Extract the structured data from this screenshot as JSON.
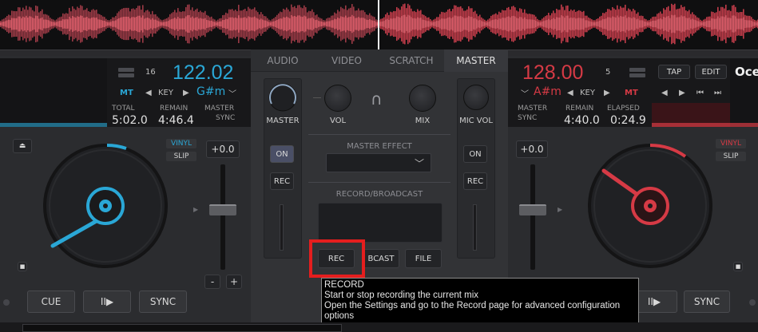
{
  "mixer": {
    "tabs": [
      "AUDIO",
      "VIDEO",
      "SCRATCH",
      "MASTER"
    ],
    "active_tab": "MASTER",
    "master_label": "MASTER",
    "on_label": "ON",
    "rec_label": "REC",
    "vol_label": "VOL",
    "mix_label": "MIX",
    "mic_vol_label": "MIC VOL",
    "master_effect_label": "MASTER EFFECT",
    "record_broadcast_label": "RECORD/BROADCAST",
    "rec_button": "REC",
    "bcast_button": "BCAST",
    "file_button": "FILE"
  },
  "left_deck": {
    "mt": "MT",
    "beat_count": "16",
    "bpm": "122.02",
    "key_label": "KEY",
    "key_value": "G#m",
    "total_label": "TOTAL",
    "total_value": "5:02.0",
    "remain_label": "REMAIN",
    "remain_value": "4:46.4",
    "master_label": "MASTER",
    "sync_label": "SYNC",
    "vinyl": "VINYL",
    "slip": "SLIP",
    "pitch": "+0.0",
    "minus": "-",
    "plus": "+",
    "cue": "CUE",
    "play": "II▶",
    "sync": "SYNC",
    "accent": "#2aa7d6"
  },
  "right_deck": {
    "bpm": "128.00",
    "beat_count": "5",
    "key_value": "A#m",
    "key_label": "KEY",
    "mt": "MT",
    "tap": "TAP",
    "edit": "EDIT",
    "title_fragment": "Oce",
    "master_label": "MASTER",
    "sync_label": "SYNC",
    "remain_label": "REMAIN",
    "remain_value": "4:40.0",
    "elapsed_label": "ELAPSED",
    "elapsed_value": "0:24.9",
    "vinyl": "VINYL",
    "slip": "SLIP",
    "pitch": "+0.0",
    "play": "II▶",
    "sync": "SYNC",
    "accent": "#d63a45"
  },
  "tooltip": {
    "title": "RECORD",
    "line1": "Start or stop recording the current mix",
    "line2": "Open the Settings and go to the Record page for advanced configuration options"
  }
}
